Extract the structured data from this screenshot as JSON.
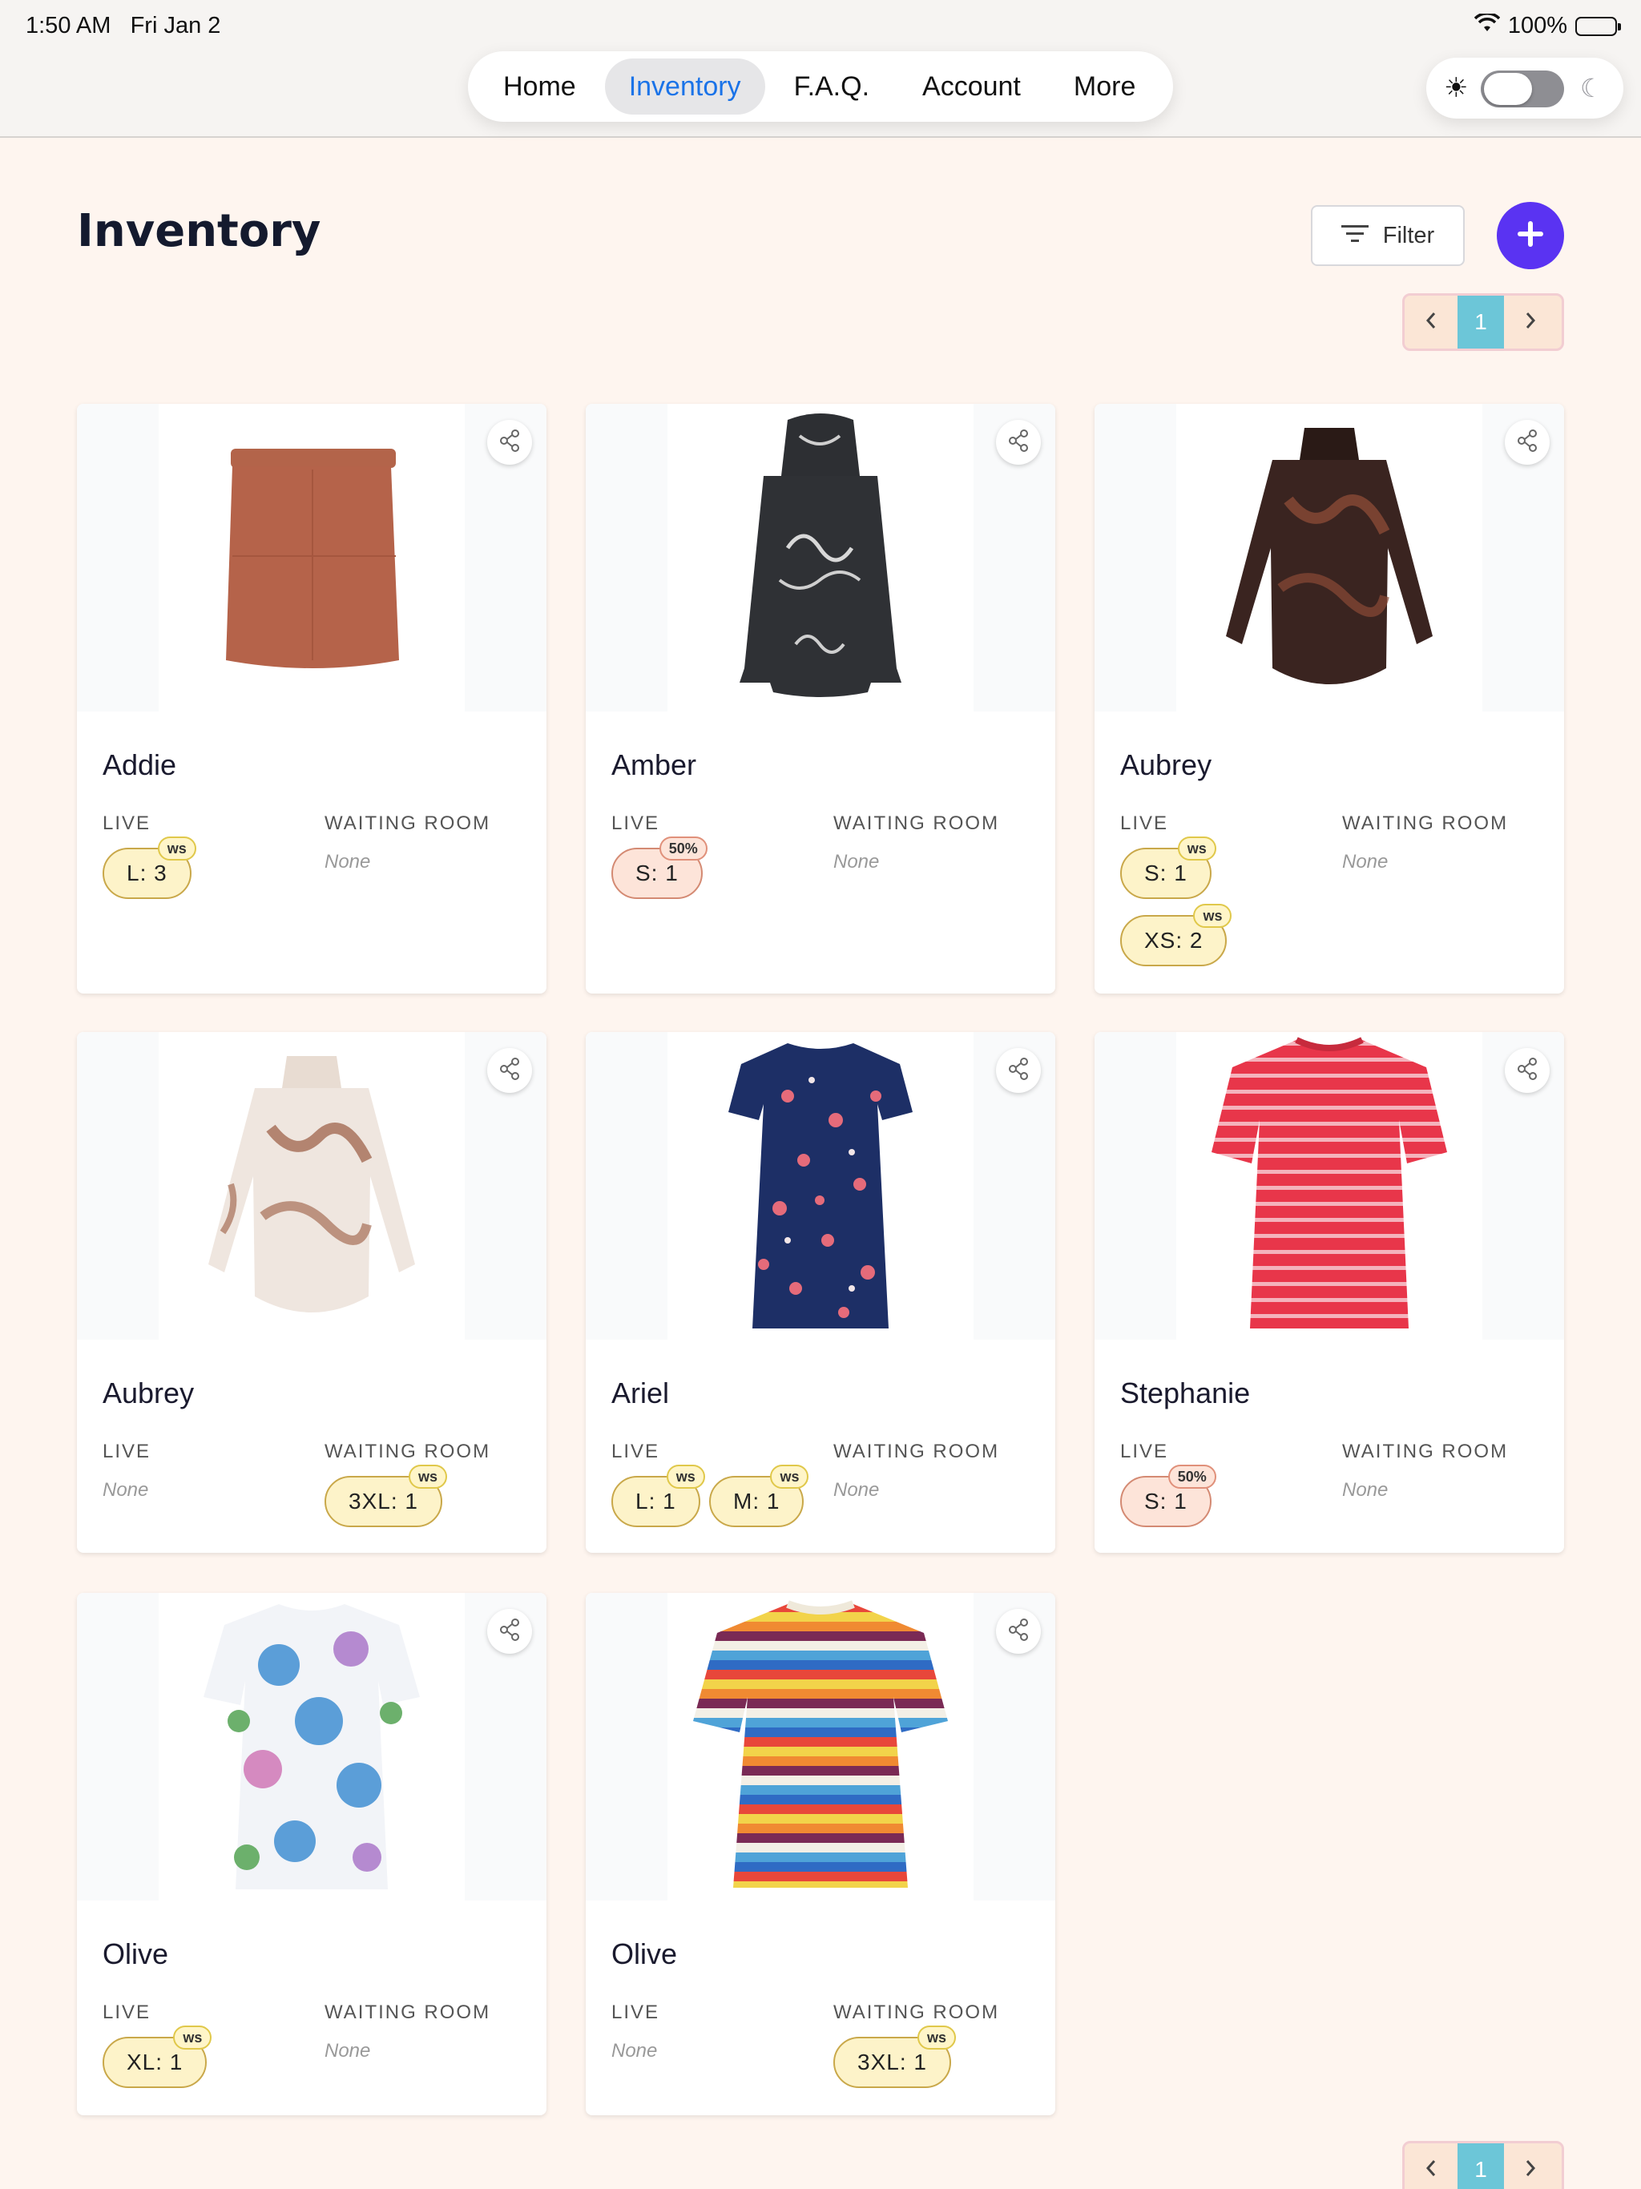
{
  "status": {
    "time": "1:50 AM",
    "date": "Fri Jan 2",
    "battery": "100%"
  },
  "nav": {
    "items": [
      "Home",
      "Inventory",
      "F.A.Q.",
      "Account",
      "More"
    ],
    "active": "Inventory"
  },
  "page": {
    "title": "Inventory",
    "filter_label": "Filter",
    "current_page": "1"
  },
  "labels": {
    "live": "LIVE",
    "waiting": "WAITING ROOM",
    "none": "None"
  },
  "colors": {
    "accent": "#5a33f2",
    "active_nav": "#1a73e8",
    "page_bg": "#fef5ef",
    "pager_active": "#6cc6d8"
  },
  "cards": [
    {
      "name": "Addie",
      "live": [
        {
          "text": "L: 3",
          "tag": "ws"
        }
      ],
      "waiting": []
    },
    {
      "name": "Amber",
      "live": [
        {
          "text": "S: 1",
          "tag": "50%"
        }
      ],
      "waiting": []
    },
    {
      "name": "Aubrey",
      "live": [
        {
          "text": "S: 1",
          "tag": "ws"
        },
        {
          "text": "XS: 2",
          "tag": "ws"
        }
      ],
      "waiting": []
    },
    {
      "name": "Aubrey",
      "live": [],
      "waiting": [
        {
          "text": "3XL: 1",
          "tag": "ws"
        }
      ]
    },
    {
      "name": "Ariel",
      "live": [
        {
          "text": "L: 1",
          "tag": "ws"
        },
        {
          "text": "M: 1",
          "tag": "ws"
        }
      ],
      "waiting": []
    },
    {
      "name": "Stephanie",
      "live": [
        {
          "text": "S: 1",
          "tag": "50%"
        }
      ],
      "waiting": []
    },
    {
      "name": "Olive",
      "live": [
        {
          "text": "XL: 1",
          "tag": "ws"
        }
      ],
      "waiting": []
    },
    {
      "name": "Olive",
      "live": [],
      "waiting": [
        {
          "text": "3XL: 1",
          "tag": "ws"
        }
      ]
    }
  ]
}
